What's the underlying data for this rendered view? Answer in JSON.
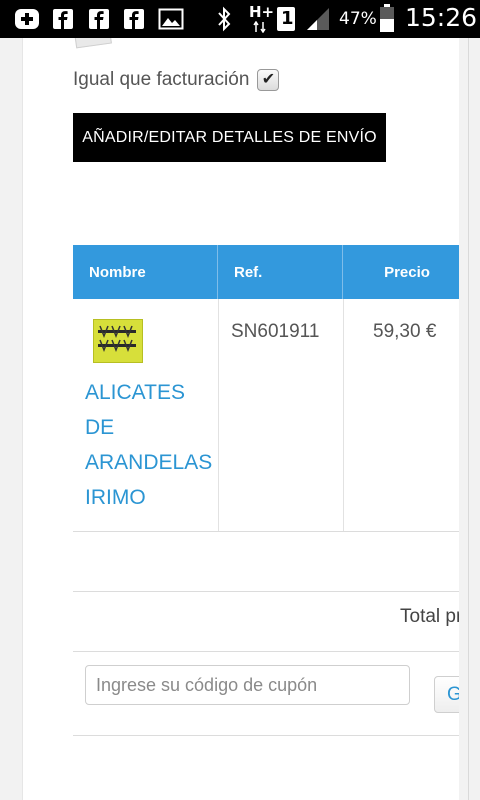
{
  "status_bar": {
    "battery_percent": "47%",
    "time": "15:26",
    "network_type": "H+",
    "sim_slot": "1",
    "icons": [
      "add-icon",
      "facebook-icon",
      "facebook-icon",
      "facebook-icon",
      "gallery-icon",
      "bluetooth-icon",
      "signal-icon",
      "battery-icon"
    ]
  },
  "shipping": {
    "same_as_billing_label": "Igual que facturación",
    "same_as_billing_checked": true,
    "edit_shipping_button": "AÑADIR/EDITAR DETALLES DE ENVÍO"
  },
  "cart_table": {
    "columns": [
      "Nombre",
      "Ref.",
      "Precio"
    ],
    "rows": [
      {
        "name_lines": [
          "ALICATES",
          "DE",
          "ARANDELAS",
          "IRIMO"
        ],
        "ref": "SN601911",
        "price": "59,30 €"
      }
    ]
  },
  "totals": {
    "total_label": "Total pre"
  },
  "coupon": {
    "placeholder": "Ingrese su código de cupón",
    "apply_button": "Gua"
  },
  "colors": {
    "header_blue": "#3399dd",
    "link_blue": "#2b95d3",
    "button_dark": "#000000"
  }
}
